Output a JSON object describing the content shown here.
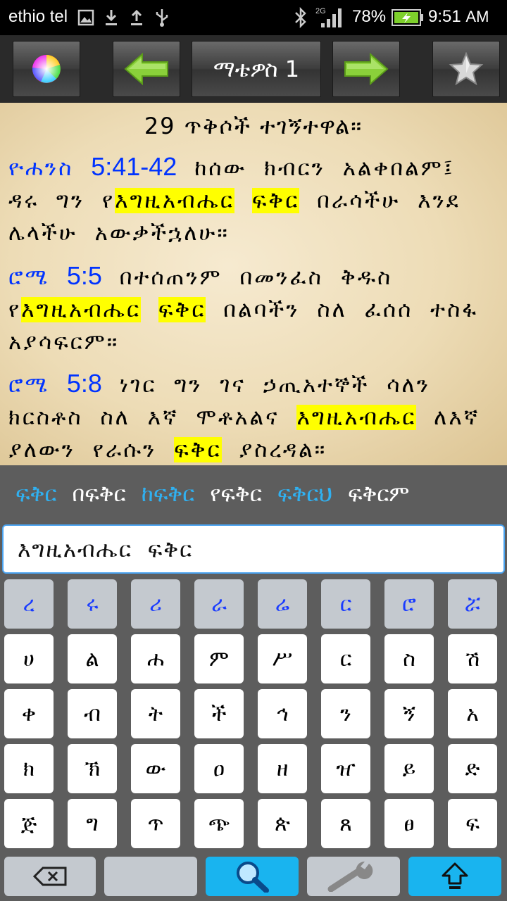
{
  "status_bar": {
    "carrier": "ethio tel",
    "network": "2G",
    "battery_percent": "78%",
    "time": "9:51",
    "ampm": "AM",
    "icons": [
      "gallery-icon",
      "download-icon",
      "upload-icon",
      "usb-icon",
      "bluetooth-icon",
      "signal-icon",
      "battery-charging-icon"
    ]
  },
  "toolbar": {
    "title": "ማቴዎስ 1",
    "icons": [
      "color-wheel-icon",
      "arrow-left-icon",
      "arrow-right-icon",
      "star-icon"
    ]
  },
  "results": {
    "found_text": "29 ጥቅሶች ተገኝተዋል።",
    "verses": [
      {
        "book": "ዮሐንስ",
        "ref": "5:41-42",
        "parts": [
          {
            "t": "ከሰው ክብርን አልቀበልም፤ ዳሩ ግን የ",
            "h": false
          },
          {
            "t": "እግዚአብሔር",
            "h": true
          },
          {
            "t": " ",
            "h": false
          },
          {
            "t": "ፍቅር",
            "h": true
          },
          {
            "t": " በራሳችሁ እንደ ሌላችሁ አውቃችኋለሁ።",
            "h": false
          }
        ]
      },
      {
        "book": "ሮሜ",
        "ref": "5:5",
        "parts": [
          {
            "t": "በተሰጠንም በመንፈስ ቅዱስ የ",
            "h": false
          },
          {
            "t": "እግዚአብሔር",
            "h": true
          },
          {
            "t": " ",
            "h": false
          },
          {
            "t": "ፍቅር",
            "h": true
          },
          {
            "t": " በልባችን ስለ ፈሰሰ ተስፋ አያሳፍርም።",
            "h": false
          }
        ]
      },
      {
        "book": "ሮሜ",
        "ref": "5:8",
        "parts": [
          {
            "t": "ነገር ግን ገና ኃጢአተኞች ሳለን ክርስቶስ ስለ እኛ ሞቶአልና ",
            "h": false
          },
          {
            "t": "እግዚአብሔር",
            "h": true
          },
          {
            "t": " ለእኛ ያለውን የራሱን ",
            "h": false
          },
          {
            "t": "ፍቅር",
            "h": true
          },
          {
            "t": " ያስረዳል።",
            "h": false
          }
        ]
      }
    ]
  },
  "suggestions": [
    {
      "label": "ፍቅር",
      "blue": true
    },
    {
      "label": "በፍቅር",
      "blue": false
    },
    {
      "label": "ከፍቅር",
      "blue": true
    },
    {
      "label": "የፍቅር",
      "blue": false
    },
    {
      "label": "ፍቅርህ",
      "blue": true
    },
    {
      "label": "ፍቅርም",
      "blue": false
    }
  ],
  "search": {
    "value": "እግዚአብሔር ፍቅር"
  },
  "keyboard": {
    "vowel_row": [
      "ረ",
      "ሩ",
      "ሪ",
      "ራ",
      "ሬ",
      "ር",
      "ሮ",
      "ሯ"
    ],
    "rows": [
      [
        "ሀ",
        "ል",
        "ሐ",
        "ም",
        "ሥ",
        "ር",
        "ስ",
        "ሽ"
      ],
      [
        "ቀ",
        "ብ",
        "ት",
        "ች",
        "ኅ",
        "ን",
        "ኝ",
        "አ"
      ],
      [
        "ክ",
        "ኽ",
        "ው",
        "ዐ",
        "ዘ",
        "ዠ",
        "ይ",
        "ድ"
      ],
      [
        "ጅ",
        "ግ",
        "ጥ",
        "ጭ",
        "ጵ",
        "ጸ",
        "ፀ",
        "ፍ"
      ]
    ],
    "function_keys": [
      "backspace-icon",
      "space-key",
      "search-icon",
      "wrench-icon",
      "shift-icon"
    ]
  }
}
